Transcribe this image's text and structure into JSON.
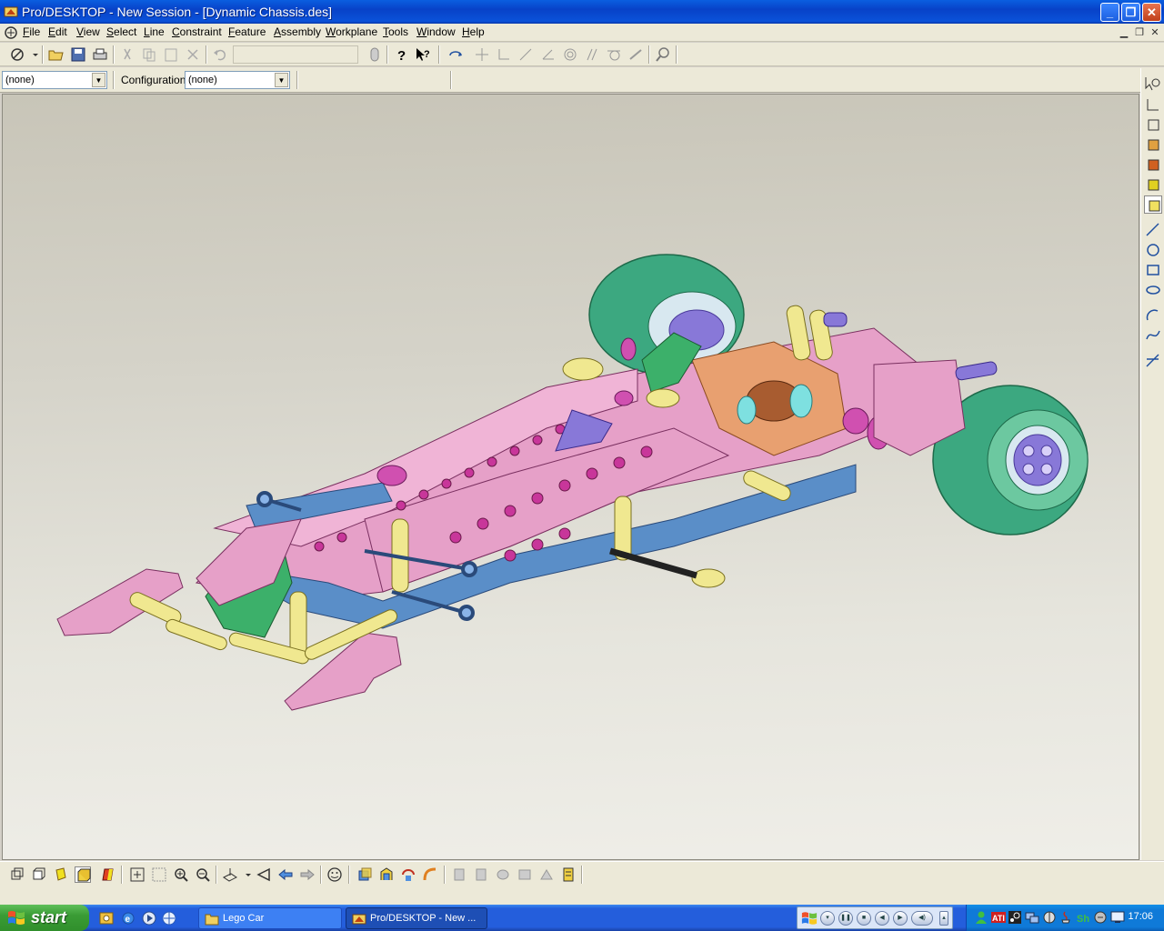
{
  "window": {
    "title": "Pro/DESKTOP - New Session - [Dynamic Chassis.des]",
    "minimize": "_",
    "maximize": "❐",
    "close": "✕"
  },
  "menu": {
    "items": [
      {
        "label": "File",
        "key": "F"
      },
      {
        "label": "Edit",
        "key": "E"
      },
      {
        "label": "View",
        "key": "V"
      },
      {
        "label": "Select",
        "key": "S"
      },
      {
        "label": "Line",
        "key": "L"
      },
      {
        "label": "Constraint",
        "key": "C"
      },
      {
        "label": "Feature",
        "key": "F"
      },
      {
        "label": "Assembly",
        "key": "A"
      },
      {
        "label": "Workplane",
        "key": "W"
      },
      {
        "label": "Tools",
        "key": "T"
      },
      {
        "label": "Window",
        "key": "W"
      },
      {
        "label": "Help",
        "key": "H"
      }
    ]
  },
  "toolbar2": {
    "first_combo_value": "(none)",
    "configuration_label": "Configuration:",
    "configuration_value": "(none)"
  },
  "taskbar": {
    "start_label": "start",
    "tasks": [
      {
        "label": "Lego Car",
        "active": false
      },
      {
        "label": "Pro/DESKTOP - New ...",
        "active": true
      }
    ],
    "clock": "17:06"
  },
  "icons": {
    "app": "pro-desktop-icon",
    "folder": "folder-icon",
    "colors": {
      "pink": "#e6a0c8",
      "magenta": "#c8369a",
      "blue": "#5a8ec8",
      "yellow": "#f0e890",
      "green": "#3cb06a",
      "tire": "#3ca880",
      "orange": "#e8a070"
    }
  }
}
